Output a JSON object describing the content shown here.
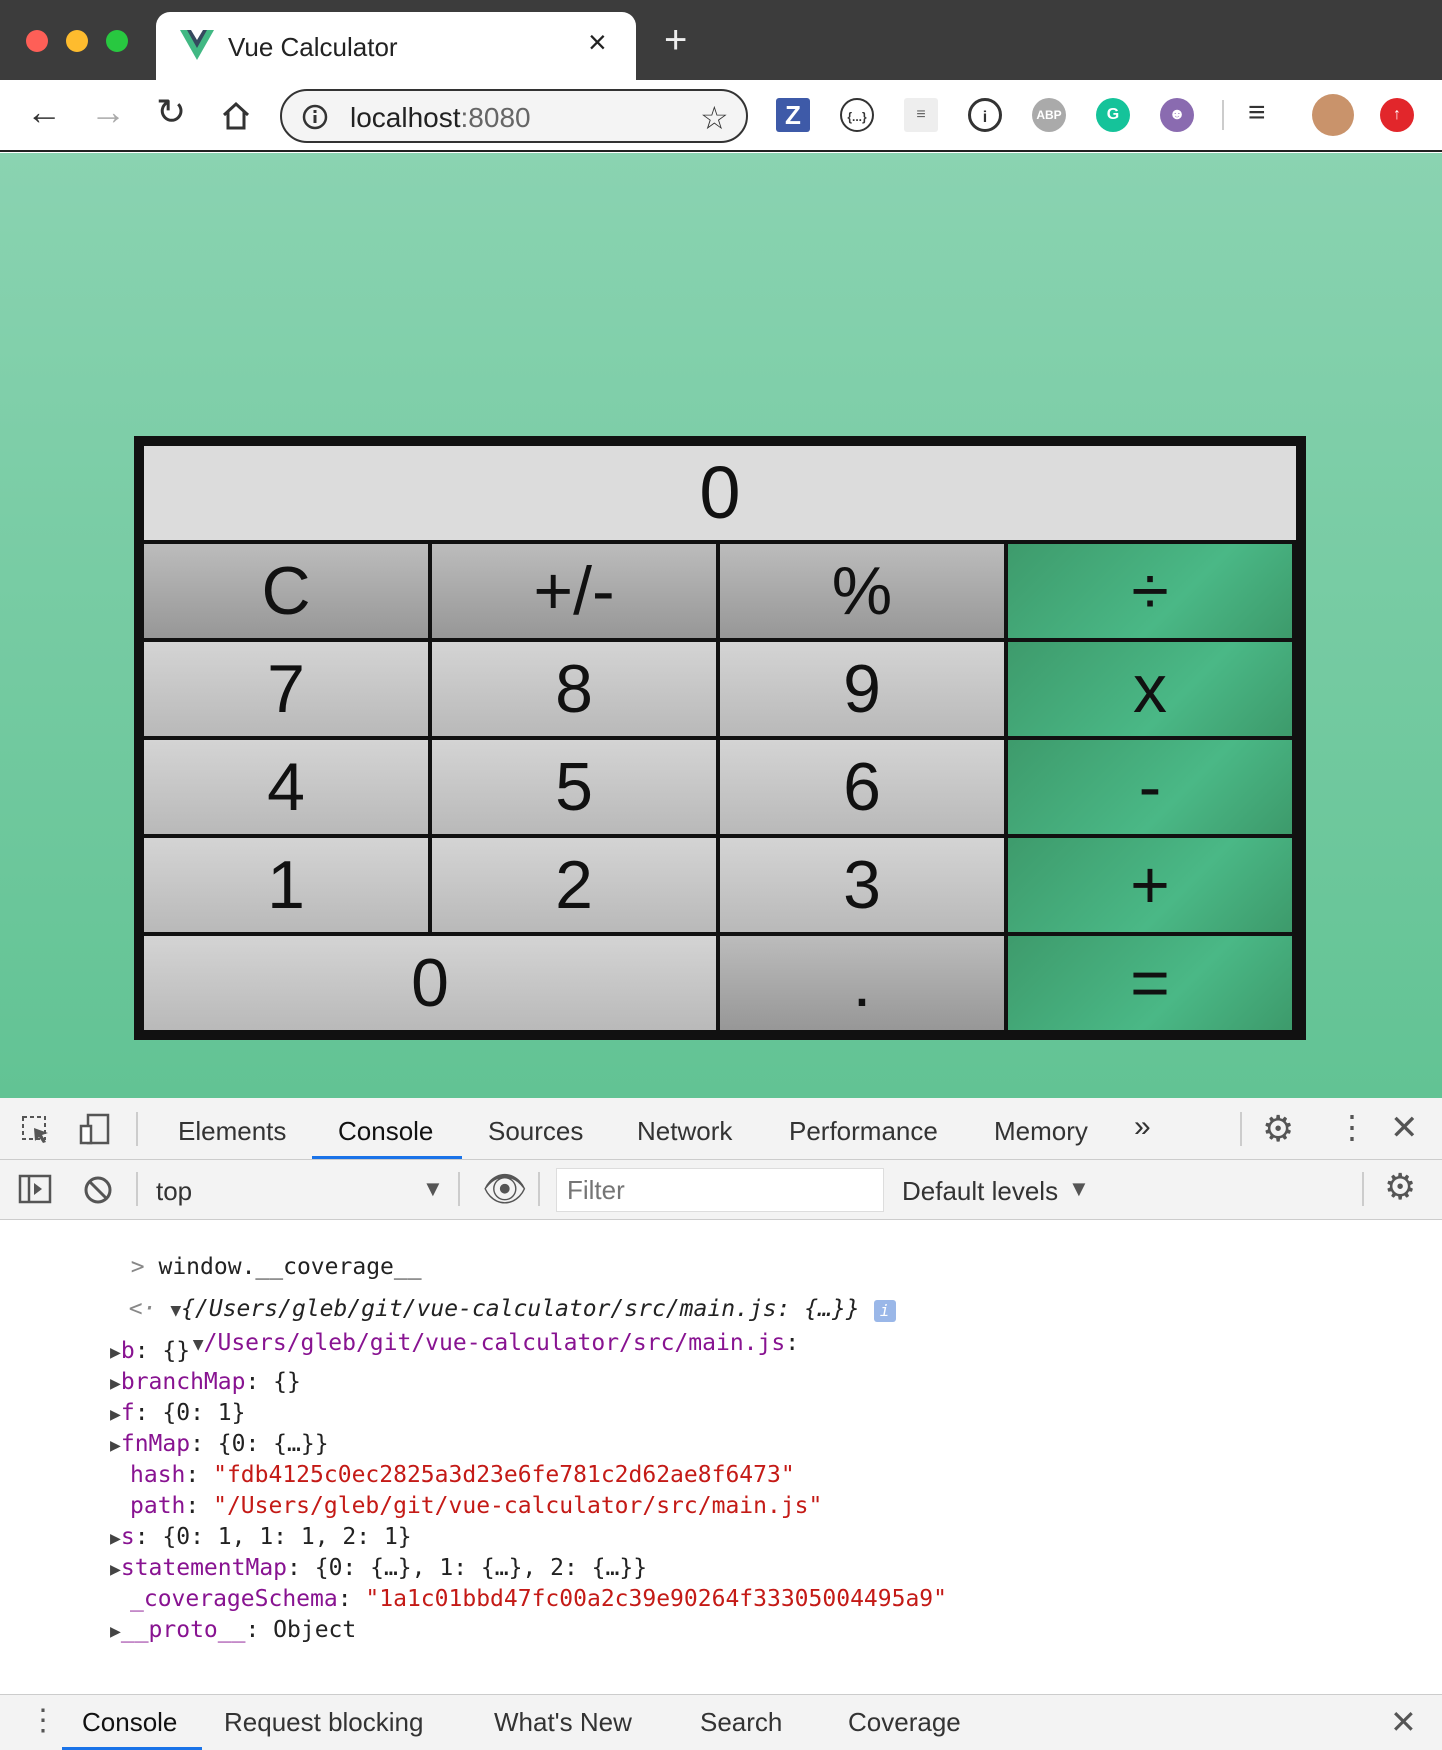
{
  "browser": {
    "tab_title": "Vue Calculator",
    "url_host": "localhost",
    "url_port": ":8080",
    "ext_labels": {
      "z": "Z",
      "json": "{...}",
      "onepass": "i",
      "abp": "ABP",
      "grammarly": "G"
    }
  },
  "calculator": {
    "display": "0",
    "keys": [
      {
        "label": "C",
        "kind": "func"
      },
      {
        "label": "+/-",
        "kind": "func"
      },
      {
        "label": "%",
        "kind": "func"
      },
      {
        "label": "÷",
        "kind": "op"
      },
      {
        "label": "7",
        "kind": "num"
      },
      {
        "label": "8",
        "kind": "num"
      },
      {
        "label": "9",
        "kind": "num"
      },
      {
        "label": "x",
        "kind": "op"
      },
      {
        "label": "4",
        "kind": "num"
      },
      {
        "label": "5",
        "kind": "num"
      },
      {
        "label": "6",
        "kind": "num"
      },
      {
        "label": "-",
        "kind": "op"
      },
      {
        "label": "1",
        "kind": "num"
      },
      {
        "label": "2",
        "kind": "num"
      },
      {
        "label": "3",
        "kind": "num"
      },
      {
        "label": "+",
        "kind": "op"
      },
      {
        "label": "0",
        "kind": "num"
      },
      {
        "label": ".",
        "kind": "func"
      },
      {
        "label": "=",
        "kind": "op"
      }
    ]
  },
  "devtools": {
    "tabs": [
      "Elements",
      "Console",
      "Sources",
      "Network",
      "Performance",
      "Memory"
    ],
    "active_tab": "Console",
    "context": "top",
    "filter_placeholder": "Filter",
    "levels": "Default levels",
    "console": {
      "input": "window.__coverage__",
      "result_summary": "{/Users/gleb/git/vue-calculator/src/main.js: {…}}",
      "file_key": "/Users/gleb/git/vue-calculator/src/main.js",
      "props": [
        {
          "key": "b",
          "value": "{}",
          "expandable": true
        },
        {
          "key": "branchMap",
          "value": "{}",
          "expandable": true
        },
        {
          "key": "f",
          "value": "{0: 1}",
          "expandable": true
        },
        {
          "key": "fnMap",
          "value": "{0: {…}}",
          "expandable": true
        },
        {
          "key": "hash",
          "value": "\"fdb4125c0ec2825a3d23e6fe781c2d62ae8f6473\"",
          "expandable": false
        },
        {
          "key": "path",
          "value": "\"/Users/gleb/git/vue-calculator/src/main.js\"",
          "expandable": false
        },
        {
          "key": "s",
          "value": "{0: 1, 1: 1, 2: 1}",
          "expandable": true
        },
        {
          "key": "statementMap",
          "value": "{0: {…}, 1: {…}, 2: {…}}",
          "expandable": true
        },
        {
          "key": "_coverageSchema",
          "value": "\"1a1c01bbd47fc00a2c39e90264f33305004495a9\"",
          "expandable": false
        },
        {
          "key": "__proto__",
          "value": "Object",
          "expandable": true
        }
      ]
    },
    "drawer_tabs": [
      "Console",
      "Request blocking",
      "What's New",
      "Search",
      "Coverage"
    ]
  }
}
